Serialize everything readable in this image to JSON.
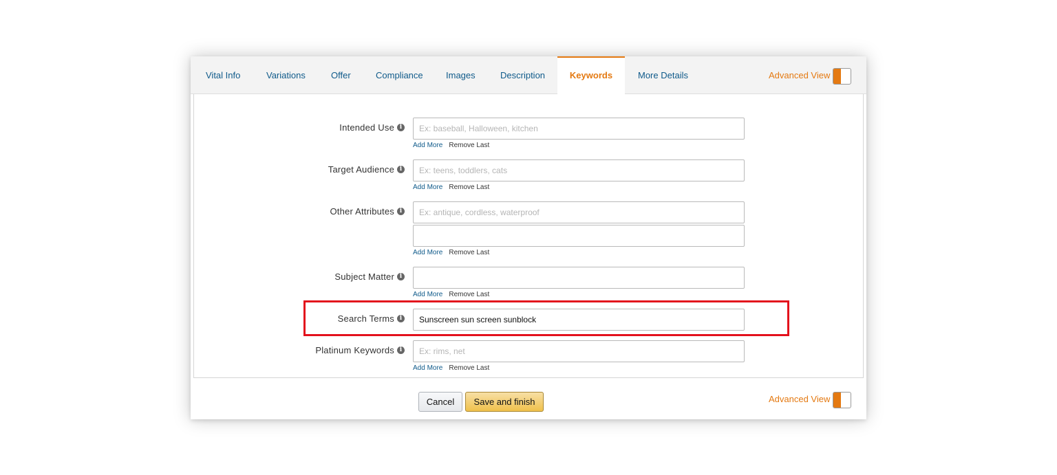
{
  "tabs": [
    {
      "label": "Vital Info",
      "active": false
    },
    {
      "label": "Variations",
      "active": false
    },
    {
      "label": "Offer",
      "active": false
    },
    {
      "label": "Compliance",
      "active": false
    },
    {
      "label": "Images",
      "active": false
    },
    {
      "label": "Description",
      "active": false
    },
    {
      "label": "Keywords",
      "active": true
    },
    {
      "label": "More Details",
      "active": false
    }
  ],
  "advanced_view": {
    "label": "Advanced View",
    "toggle_on": true
  },
  "fields": {
    "intended_use": {
      "label": "Intended Use",
      "placeholder": "Ex: baseball, Halloween, kitchen",
      "value": ""
    },
    "target_audience": {
      "label": "Target Audience",
      "placeholder": "Ex: teens, toddlers, cats",
      "value": ""
    },
    "other_attributes": {
      "label": "Other Attributes",
      "placeholder": "Ex: antique, cordless, waterproof",
      "value": "",
      "value2": ""
    },
    "subject_matter": {
      "label": "Subject Matter",
      "placeholder": "",
      "value": ""
    },
    "search_terms": {
      "label": "Search Terms",
      "placeholder": "",
      "value": "Sunscreen sun screen sunblock"
    },
    "platinum_keywords": {
      "label": "Platinum Keywords",
      "placeholder": "Ex: rims, net",
      "value": ""
    }
  },
  "links": {
    "add_more": "Add More",
    "remove_last": "Remove Last"
  },
  "info_icon": {
    "glyph": "i",
    "icon": "info-icon"
  },
  "buttons": {
    "cancel": "Cancel",
    "save_and_finish": "Save and finish"
  },
  "colors": {
    "accent": "#e47911",
    "link": "#0f5a8a",
    "highlight": "#e3101c",
    "save_button": "#f0c14b"
  }
}
